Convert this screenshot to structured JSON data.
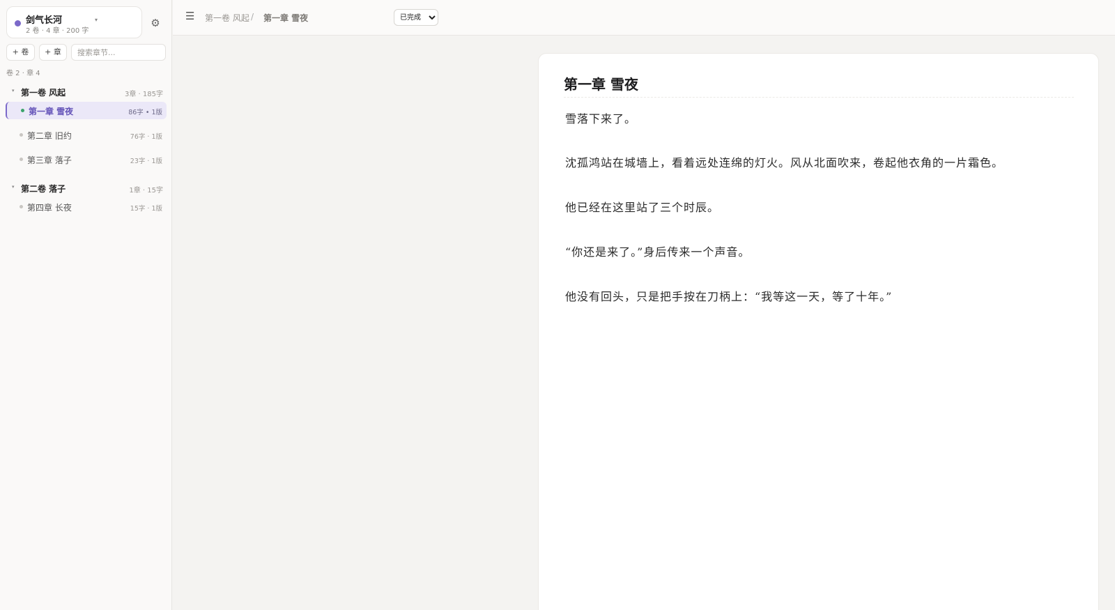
{
  "project": {
    "name": "剑气长河",
    "meta": "2 卷 · 4 章 · 200 字",
    "accent_color": "#7b69c9"
  },
  "sidebar": {
    "add_volume_label": "+ 卷",
    "add_chapter_label": "+ 章",
    "search_placeholder": "搜索章节...",
    "counts": "卷 2 · 章 4",
    "volumes": [
      {
        "title": "第一卷 风起",
        "meta": "3章 · 185字",
        "chapters": [
          {
            "title": "第一章 雪夜",
            "meta": "86字 • 1版",
            "active": true
          },
          {
            "title": "第二章 旧约",
            "meta": "76字 · 1版",
            "active": false
          },
          {
            "title": "第三章 落子",
            "meta": "23字 · 1版",
            "active": false
          }
        ]
      },
      {
        "title": "第二卷 落子",
        "meta": "1章 · 15字",
        "chapters": [
          {
            "title": "第四章 长夜",
            "meta": "15字 · 1版",
            "active": false
          }
        ]
      }
    ]
  },
  "topbar": {
    "breadcrumb_volume": "第一卷 风起",
    "breadcrumb_sep": "/",
    "breadcrumb_chapter": "第一章 雪夜",
    "status_value": "已完成"
  },
  "editor": {
    "title": "第一章 雪夜",
    "paragraphs": [
      "雪落下来了。",
      "沈孤鸿站在城墙上，看着远处连绵的灯火。风从北面吹来，卷起他衣角的一片霜色。",
      "他已经在这里站了三个时辰。",
      "“你还是来了。”身后传来一个声音。",
      "他没有回头，只是把手按在刀柄上：“我等这一天，等了十年。”"
    ]
  }
}
